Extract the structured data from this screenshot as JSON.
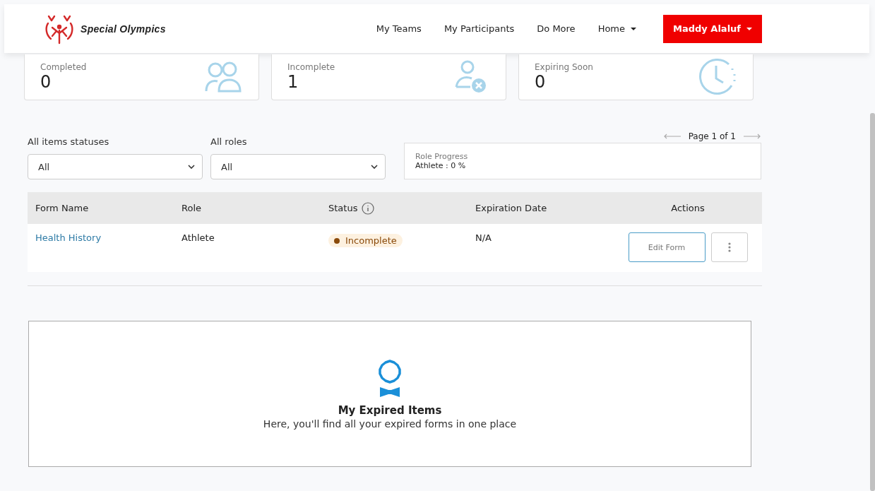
{
  "header": {
    "logo_text": "Special Olympics",
    "nav": [
      {
        "label": "My Teams",
        "dropdown": false,
        "highlighted": false
      },
      {
        "label": "My Participants",
        "dropdown": false,
        "highlighted": false
      },
      {
        "label": "Do More",
        "dropdown": false,
        "highlighted": false
      },
      {
        "label": "Home",
        "dropdown": true,
        "highlighted": false
      },
      {
        "label": "Maddy Alaluf",
        "dropdown": true,
        "highlighted": true
      }
    ]
  },
  "stats": [
    {
      "label": "Completed",
      "value": "0",
      "kind": "people"
    },
    {
      "label": "Incomplete",
      "value": "1",
      "kind": "person-x"
    },
    {
      "label": "Expiring Soon",
      "value": "0",
      "kind": "clock"
    }
  ],
  "filters": [
    {
      "label": "All items statuses",
      "value": "All"
    },
    {
      "label": "All roles",
      "value": "All"
    }
  ],
  "pagination": {
    "text": "Page 1 of 1"
  },
  "role_progress": {
    "title": "Role Progress",
    "value": "Athlete : 0 %"
  },
  "table": {
    "columns": [
      "Form Name",
      "Role",
      "Status",
      "Expiration Date",
      "Actions"
    ],
    "rows": [
      {
        "form_name": "Health History",
        "role": "Athlete",
        "status": "Incomplete",
        "color": "#8a4a0a",
        "expiration": "N/A",
        "action": "Edit Form"
      }
    ]
  },
  "empty_state": {
    "title": "My Expired Items",
    "text": "Here, you'll find all your expired forms in one place"
  }
}
